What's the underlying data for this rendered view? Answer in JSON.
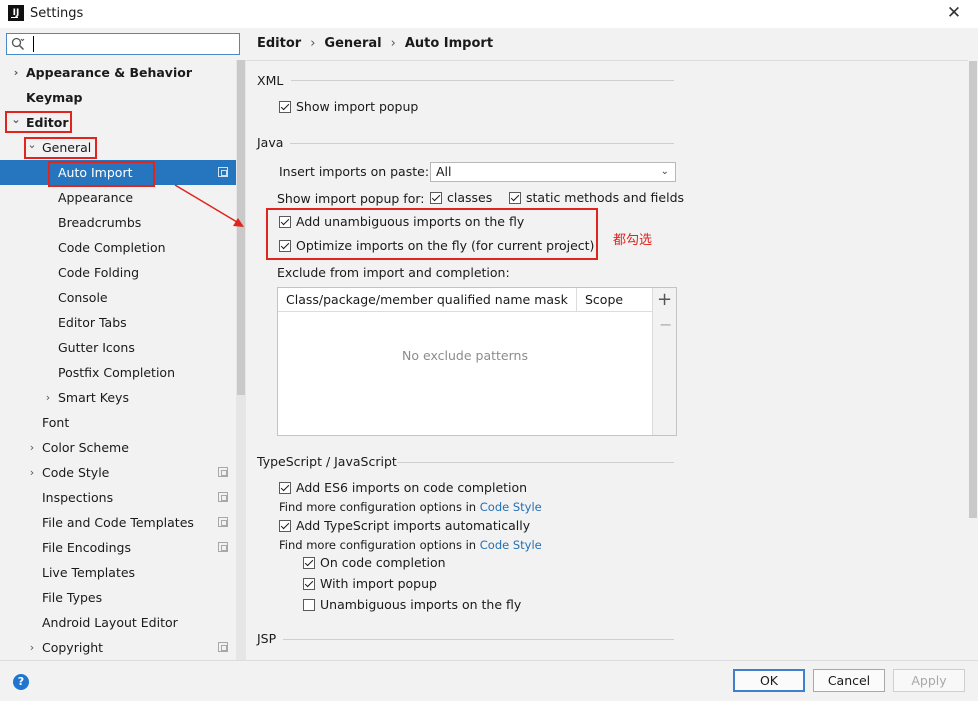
{
  "window": {
    "title": "Settings",
    "app_icon_text": "IJ"
  },
  "search": {
    "placeholder": "",
    "value": ""
  },
  "sidebar": {
    "items": [
      {
        "label": "Appearance & Behavior",
        "arrow": "›",
        "bold": true
      },
      {
        "label": "Keymap",
        "bold": true
      },
      {
        "label": "Editor",
        "arrow": "⌄",
        "bold": true
      },
      {
        "label": "General",
        "arrow": "⌄"
      },
      {
        "label": "Auto Import",
        "selected": true
      },
      {
        "label": "Appearance"
      },
      {
        "label": "Breadcrumbs"
      },
      {
        "label": "Code Completion"
      },
      {
        "label": "Code Folding"
      },
      {
        "label": "Console"
      },
      {
        "label": "Editor Tabs"
      },
      {
        "label": "Gutter Icons"
      },
      {
        "label": "Postfix Completion"
      },
      {
        "label": "Smart Keys",
        "arrow": "›"
      },
      {
        "label": "Font"
      },
      {
        "label": "Color Scheme",
        "arrow": "›"
      },
      {
        "label": "Code Style",
        "arrow": "›"
      },
      {
        "label": "Inspections"
      },
      {
        "label": "File and Code Templates"
      },
      {
        "label": "File Encodings"
      },
      {
        "label": "Live Templates"
      },
      {
        "label": "File Types"
      },
      {
        "label": "Android Layout Editor"
      },
      {
        "label": "Copyright",
        "arrow": "›"
      }
    ]
  },
  "breadcrumb": {
    "part1": "Editor",
    "part2": "General",
    "part3": "Auto Import",
    "sep": "›"
  },
  "xml": {
    "title": "XML",
    "show_import_popup": {
      "label": "Show import popup",
      "checked": true
    }
  },
  "java": {
    "title": "Java",
    "insert_imports_label": "Insert imports on paste:",
    "insert_imports_value": "All",
    "show_popup_for_label": "Show import popup for:",
    "classes": {
      "label": "classes",
      "checked": true
    },
    "static_methods": {
      "label": "static methods and fields",
      "checked": true
    },
    "add_unambiguous": {
      "label": "Add unambiguous imports on the fly",
      "checked": true
    },
    "optimize_imports": {
      "label": "Optimize imports on the fly (for current project)",
      "checked": true
    },
    "exclude_label": "Exclude from import and completion:",
    "exclude_table": {
      "col1": "Class/package/member qualified name mask",
      "col2": "Scope",
      "empty": "No exclude patterns",
      "add": "+",
      "remove": "−"
    }
  },
  "annotation": {
    "text": "都勾选",
    "color": "#e0241e"
  },
  "typescript": {
    "title": "TypeScript / JavaScript",
    "es6": {
      "label": "Add ES6 imports on code completion",
      "checked": true
    },
    "find_more_1": "Find more configuration options in",
    "code_style_link_1": "Code Style",
    "ts_auto": {
      "label": "Add TypeScript imports automatically",
      "checked": true
    },
    "find_more_2": "Find more configuration options in",
    "code_style_link_2": "Code Style",
    "on_code_completion": {
      "label": "On code completion",
      "checked": true
    },
    "with_import_popup": {
      "label": "With import popup",
      "checked": true
    },
    "unambiguous": {
      "label": "Unambiguous imports on the fly",
      "checked": false
    }
  },
  "jsp": {
    "title": "JSP"
  },
  "buttons": {
    "ok": "OK",
    "cancel": "Cancel",
    "apply": "Apply",
    "help": "?"
  },
  "colors": {
    "accent": "#2675bf",
    "highlight": "#e0241e",
    "link": "#2470b3"
  }
}
